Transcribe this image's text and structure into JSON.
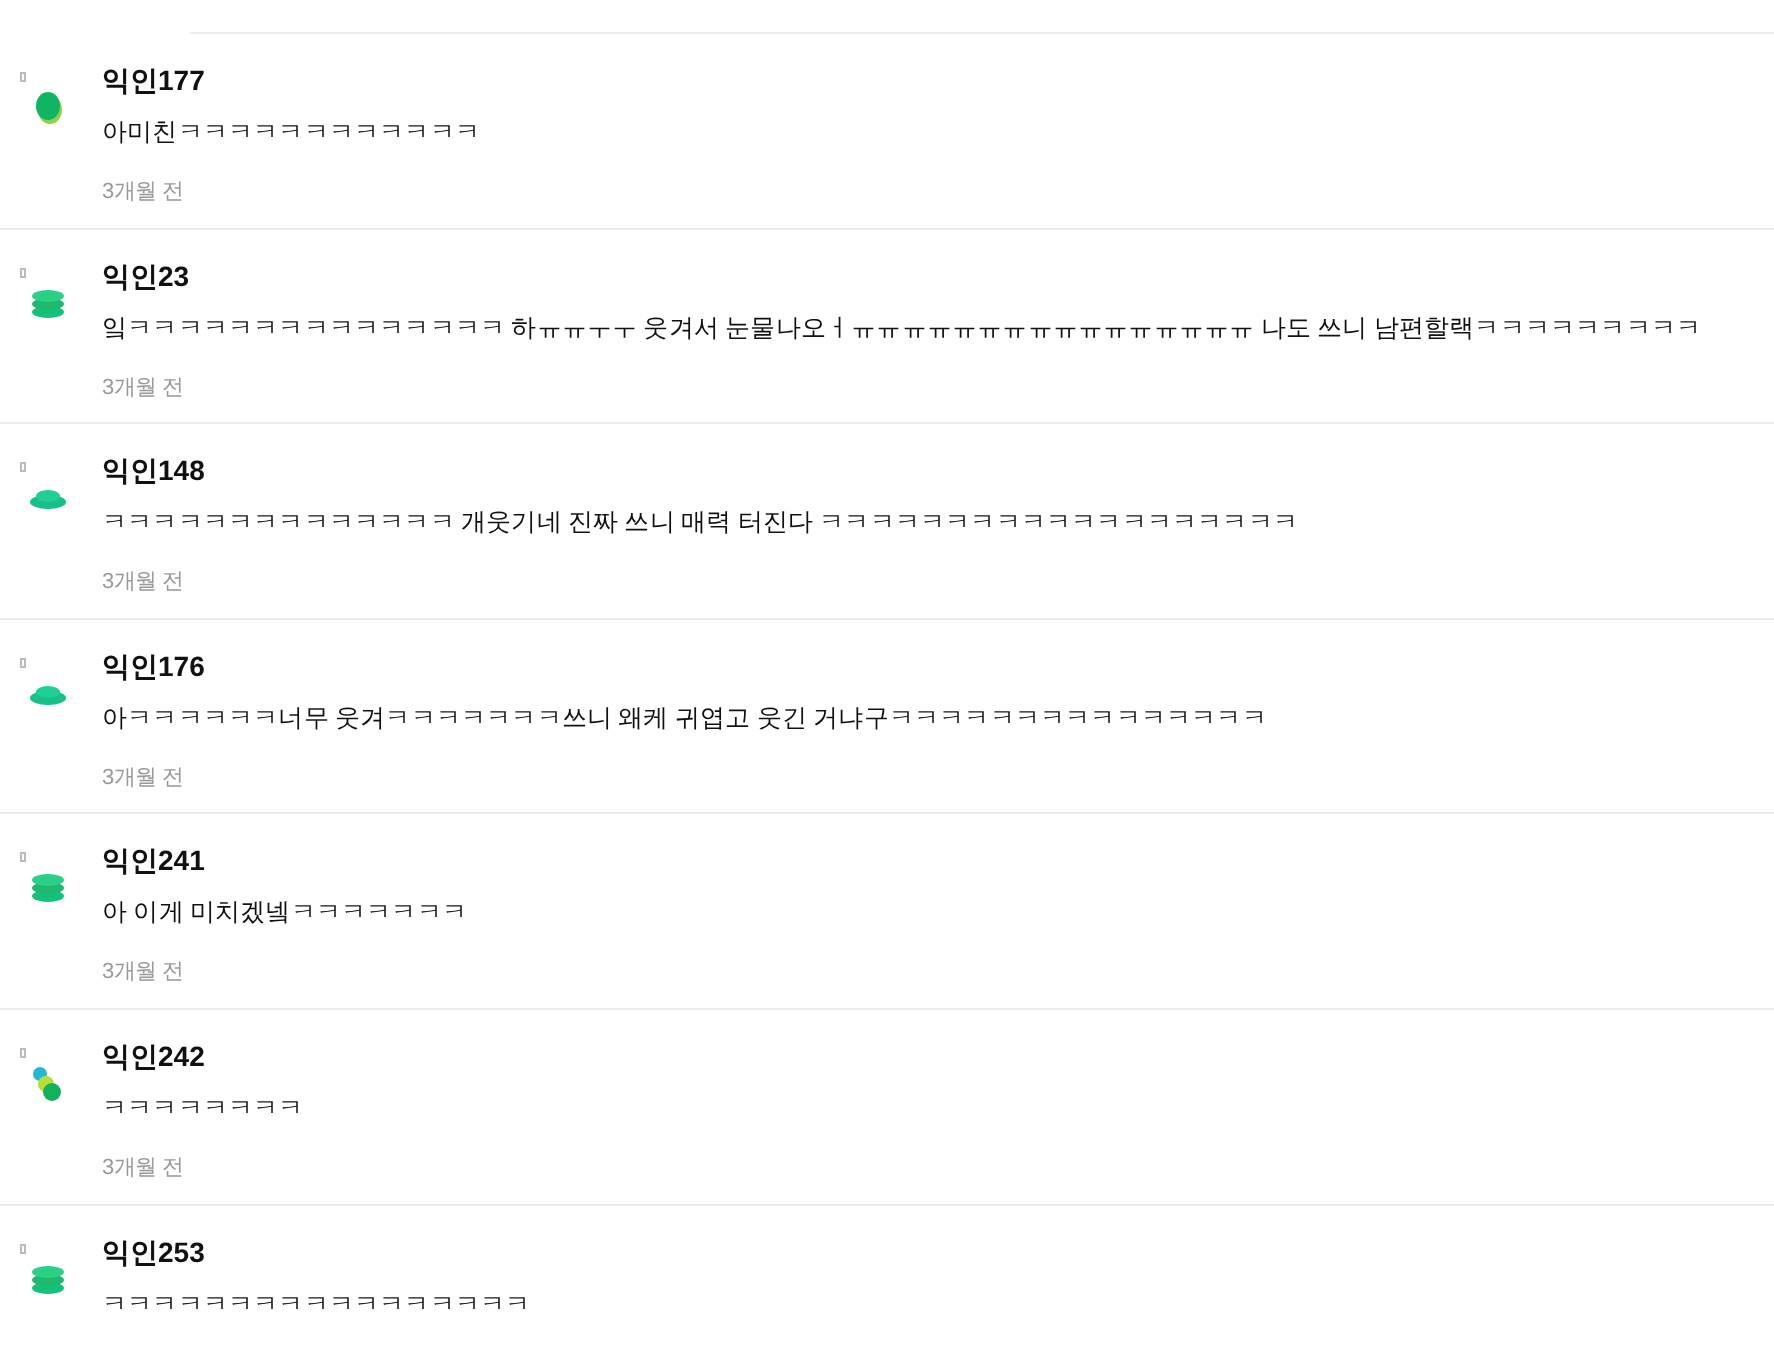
{
  "comments": [
    {
      "author": "익인177",
      "avatar": {
        "kind": "blob"
      },
      "text": "아미친ㅋㅋㅋㅋㅋㅋㅋㅋㅋㅋㅋㅋ",
      "time": "3개월 전"
    },
    {
      "author": "익인23",
      "avatar": {
        "kind": "stack"
      },
      "text": "잌ㅋㅋㅋㅋㅋㅋㅋㅋㅋㅋㅋㅋㅋㅋㅋ 하ㅠㅠㅜㅜ 웃겨서 눈물나오ㅓㅠㅠㅠㅠㅠㅠㅠㅠㅠㅠㅠㅠㅠㅠㅠㅠ 나도 쓰니 남편할랙ㅋㅋㅋㅋㅋㅋㅋㅋㅋ",
      "time": "3개월 전"
    },
    {
      "author": "익인148",
      "avatar": {
        "kind": "disc"
      },
      "text": "ㅋㅋㅋㅋㅋㅋㅋㅋㅋㅋㅋㅋㅋㅋ 개웃기네 진짜 쓰니 매력 터진다 ㅋㅋㅋㅋㅋㅋㅋㅋㅋㅋㅋㅋㅋㅋㅋㅋㅋㅋㅋ",
      "time": "3개월 전"
    },
    {
      "author": "익인176",
      "avatar": {
        "kind": "disc"
      },
      "text": "아ㅋㅋㅋㅋㅋㅋ너무 웃겨ㅋㅋㅋㅋㅋㅋㅋ쓰니 왜케 귀엽고 웃긴 거냐구ㅋㅋㅋㅋㅋㅋㅋㅋㅋㅋㅋㅋㅋㅋㅋ",
      "time": "3개월 전"
    },
    {
      "author": "익인241",
      "avatar": {
        "kind": "stack"
      },
      "text": "아 이게 미치겠넼ㅋㅋㅋㅋㅋㅋㅋ",
      "time": "3개월 전"
    },
    {
      "author": "익인242",
      "avatar": {
        "kind": "dots"
      },
      "text": "ㅋㅋㅋㅋㅋㅋㅋㅋ",
      "time": "3개월 전"
    },
    {
      "author": "익인253",
      "avatar": {
        "kind": "stack"
      },
      "text": "ㅋㅋㅋㅋㅋㅋㅋㅋㅋㅋㅋㅋㅋㅋㅋㅋㅋ"
    }
  ]
}
